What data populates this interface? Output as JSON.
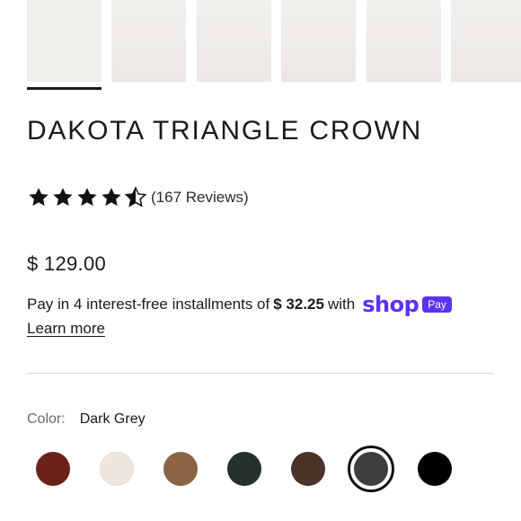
{
  "product": {
    "title": "DAKOTA TRIANGLE CROWN",
    "rating": 4.5,
    "reviews_label": "(167 Reviews)",
    "price": "$ 129.00",
    "installments_prefix": "Pay in 4 interest-free installments of",
    "installment_amount": "$ 32.25",
    "installments_with": "with",
    "shop_logo": "shop",
    "pay_badge": "Pay",
    "learn_more": "Learn more"
  },
  "gallery": {
    "thumbnails": [
      {
        "kind": "hat-only",
        "active": true
      },
      {
        "kind": "model-front"
      },
      {
        "kind": "model-front"
      },
      {
        "kind": "model-front"
      },
      {
        "kind": "model-side"
      },
      {
        "kind": "model-back"
      }
    ]
  },
  "color": {
    "label": "Color:",
    "value": "Dark Grey",
    "swatches": [
      {
        "name": "rust",
        "hex": "#6b2218"
      },
      {
        "name": "cream",
        "hex": "#ece6dc"
      },
      {
        "name": "tan",
        "hex": "#8a6443"
      },
      {
        "name": "green",
        "hex": "#23312a"
      },
      {
        "name": "brown",
        "hex": "#4a3329"
      },
      {
        "name": "dark-grey",
        "hex": "#3e3e40",
        "selected": true
      },
      {
        "name": "black",
        "hex": "#000000"
      }
    ]
  },
  "colors": {
    "text": "#1a1a1a",
    "shop_purple": "#5a31f4",
    "coat": "#c59a72",
    "hat": "#3a3a3a",
    "hair": "#e6d4a8"
  }
}
